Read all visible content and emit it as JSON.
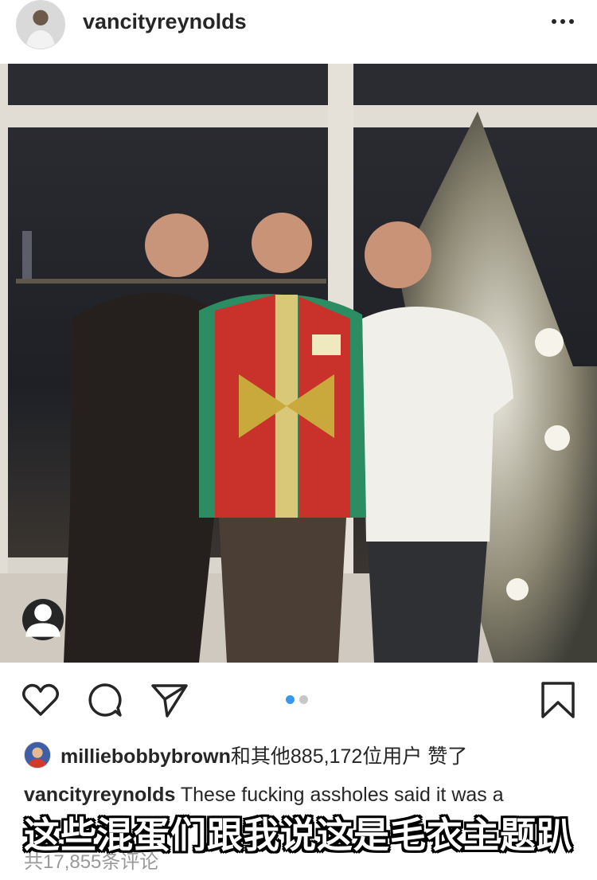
{
  "post": {
    "username": "vancityreynolds",
    "more_icon": "more-horizontal-icon"
  },
  "photo": {
    "alt_icon": "photo",
    "tag_icon": "user-tag-icon",
    "carousel_count": 2,
    "carousel_active": 1
  },
  "actions": {
    "like_icon": "heart-icon",
    "comment_icon": "comment-icon",
    "share_icon": "send-icon",
    "save_icon": "bookmark-icon"
  },
  "likes": {
    "user": "milliebobbybrown",
    "rest": "和其他885,172位用户 赞了"
  },
  "caption": {
    "user": "vancityreynolds",
    "text": "These fucking assholes said it was a"
  },
  "comments": {
    "label": "共17,855条评论"
  },
  "subtitle": {
    "text": "这些混蛋们跟我说这是毛衣主题趴"
  },
  "colors": {
    "text": "#262626",
    "muted": "#999999",
    "carousel_active": "#3897f0",
    "carousel_inactive": "#c7c7c7"
  }
}
